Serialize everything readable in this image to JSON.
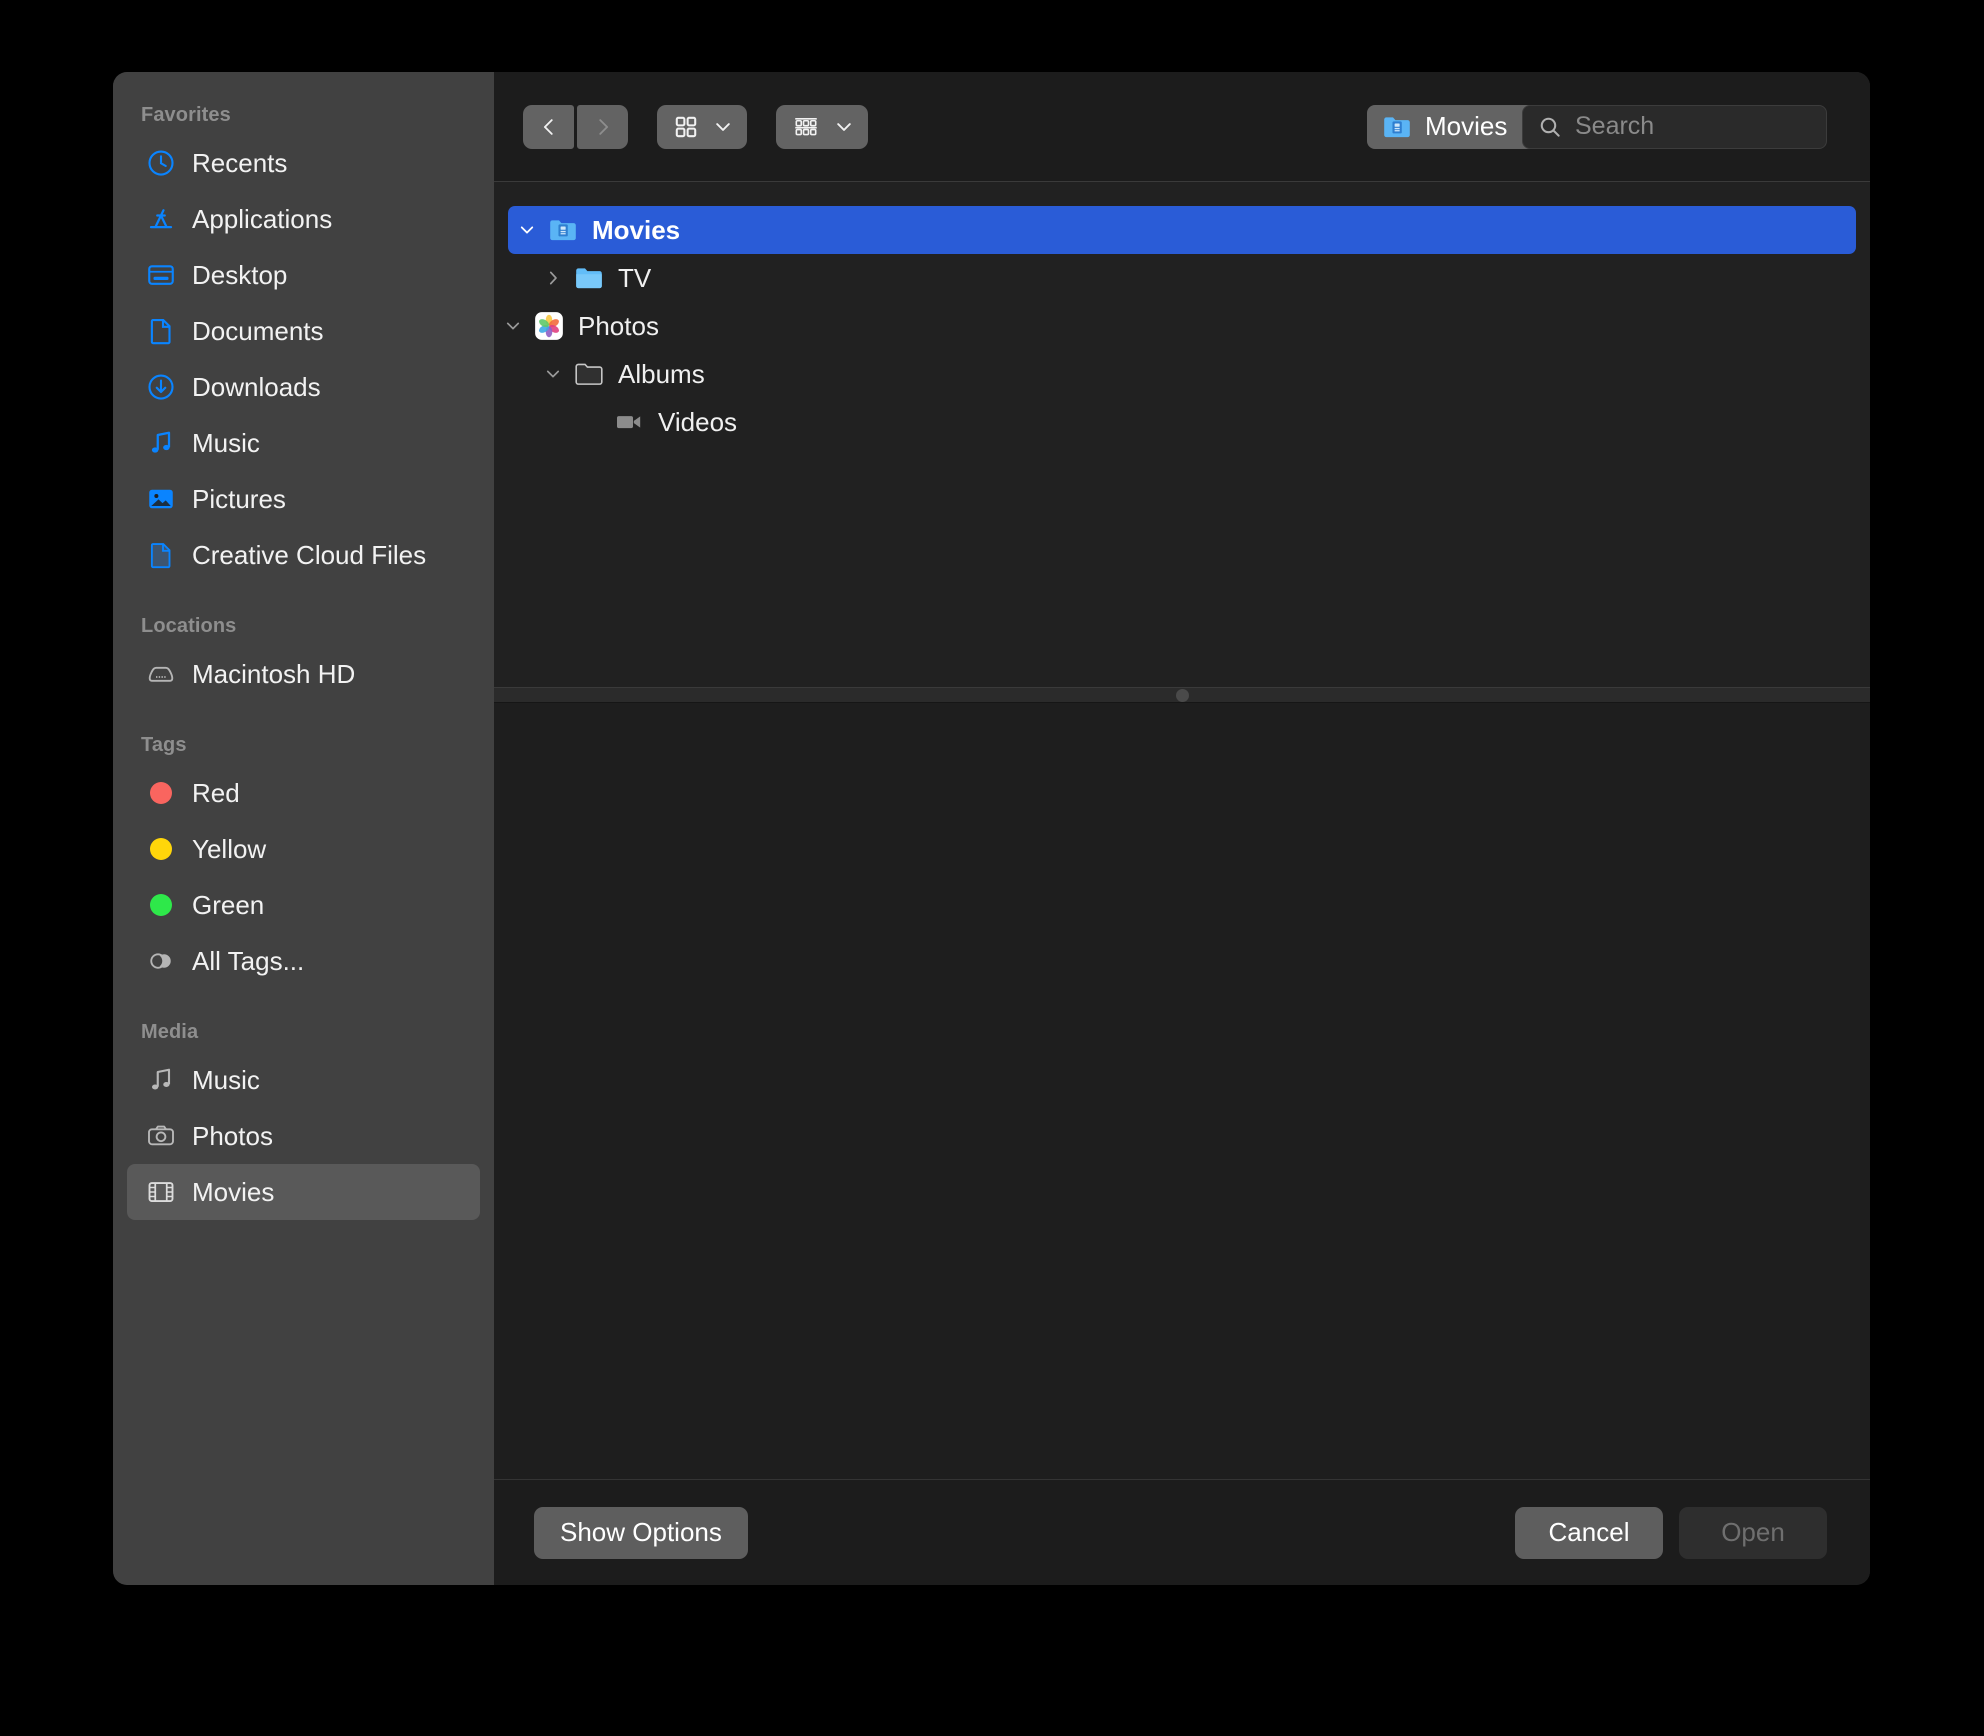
{
  "dialog": {
    "title": "Open"
  },
  "sidebar": {
    "groups": [
      {
        "header": "Favorites",
        "items": [
          {
            "label": "Recents",
            "icon": "clock-icon"
          },
          {
            "label": "Applications",
            "icon": "applications-icon"
          },
          {
            "label": "Desktop",
            "icon": "desktop-icon"
          },
          {
            "label": "Documents",
            "icon": "document-icon"
          },
          {
            "label": "Downloads",
            "icon": "download-icon"
          },
          {
            "label": "Music",
            "icon": "music-note-icon"
          },
          {
            "label": "Pictures",
            "icon": "picture-icon"
          },
          {
            "label": "Creative Cloud Files",
            "icon": "creative-cloud-file-icon"
          }
        ]
      },
      {
        "header": "Locations",
        "items": [
          {
            "label": "Macintosh HD",
            "icon": "hard-drive-icon"
          }
        ]
      },
      {
        "header": "Tags",
        "items": [
          {
            "label": "Red",
            "icon": "tag-dot-icon",
            "color": "#f9655f"
          },
          {
            "label": "Yellow",
            "icon": "tag-dot-icon",
            "color": "#ffd60a"
          },
          {
            "label": "Green",
            "icon": "tag-dot-icon",
            "color": "#2ee84a"
          },
          {
            "label": "All Tags...",
            "icon": "all-tags-icon"
          }
        ]
      },
      {
        "header": "Media",
        "items": [
          {
            "label": "Music",
            "icon": "music-note-icon"
          },
          {
            "label": "Photos",
            "icon": "camera-icon"
          },
          {
            "label": "Movies",
            "icon": "film-strip-icon",
            "selected": true
          }
        ]
      }
    ]
  },
  "toolbar": {
    "back_icon": "chevron-left-icon",
    "forward_icon": "chevron-right-icon",
    "view_mode_icon": "grid-view-icon",
    "view_mode_chevron": "chevron-down-icon",
    "group_by_icon": "group-by-icon",
    "group_by_chevron": "chevron-down-icon",
    "path": {
      "label": "Movies",
      "icon": "blue-folder-movies-icon",
      "stepper_icon": "up-down-stepper-icon"
    },
    "search": {
      "placeholder": "Search",
      "icon": "search-icon"
    }
  },
  "tree": {
    "rows": [
      {
        "label": "Movies",
        "icon": "blue-folder-movies-icon",
        "disclosure": "expanded",
        "indent": 0,
        "selected": true
      },
      {
        "label": "TV",
        "icon": "blue-folder-icon",
        "disclosure": "collapsed",
        "indent": 1,
        "selected": false
      },
      {
        "label": "Photos",
        "icon": "photos-app-icon",
        "disclosure": "expanded",
        "indent": 0,
        "selected": false
      },
      {
        "label": "Albums",
        "icon": "gray-folder-icon",
        "disclosure": "expanded",
        "indent": 1,
        "selected": false
      },
      {
        "label": "Videos",
        "icon": "video-camera-icon",
        "disclosure": "none",
        "indent": 2,
        "selected": false
      }
    ]
  },
  "bottom": {
    "show_options_label": "Show Options",
    "cancel_label": "Cancel",
    "open_label": "Open"
  },
  "colors": {
    "accent": "#2a5cd7",
    "sidebar_bg": "#414141",
    "content_bg": "#1e1e1e",
    "icon_blue": "#0a84ff"
  }
}
